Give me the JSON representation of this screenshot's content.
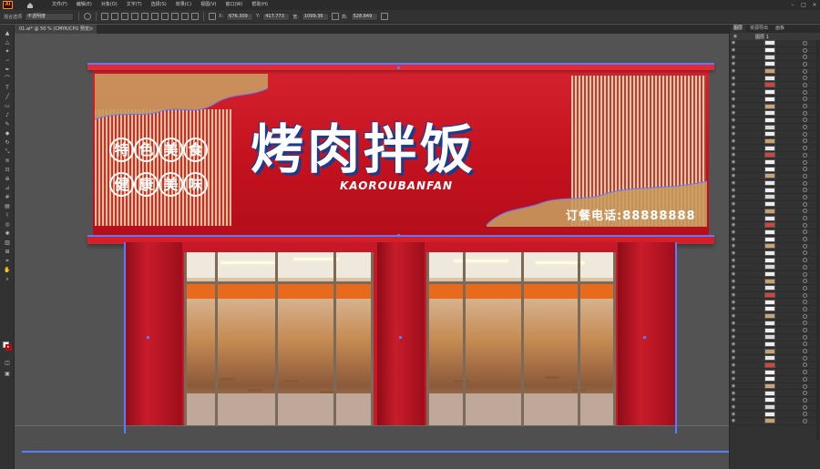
{
  "menubar": {
    "app_logo": "Ai",
    "items": [
      "文件(F)",
      "编辑(E)",
      "对象(O)",
      "文字(T)",
      "选择(S)",
      "效果(C)",
      "视图(V)",
      "窗口(W)",
      "帮助(H)"
    ]
  },
  "controlbar": {
    "label": "混合选项",
    "opacity_value": "不透明度",
    "x_label": "X:",
    "x_value": "676.309",
    "y_label": "Y:",
    "y_value": "417.773",
    "w_label": "宽:",
    "w_value": "1099.36",
    "h_label": "高:",
    "h_value": "528.849"
  },
  "document": {
    "tab_label": "01.ai* @ 50 % (CMYK/CPU 预览)",
    "close_glyph": "×"
  },
  "storefront": {
    "title": "烤肉拌饭",
    "subtitle": "KAOROUBANFAN",
    "tag_line1": [
      "特",
      "色",
      "美",
      "食"
    ],
    "tag_line2": [
      "健",
      "康",
      "美",
      "味"
    ],
    "phone": "订餐电话:88888888"
  },
  "panel": {
    "tabs": [
      "图层",
      "资源导出",
      "画板"
    ],
    "top_layer": "图层 1",
    "layer_count": 55
  },
  "colors": {
    "facade_red": "#c5121f",
    "guide_blue": "#5b7bff",
    "text_outline": "#1b3c8c"
  }
}
